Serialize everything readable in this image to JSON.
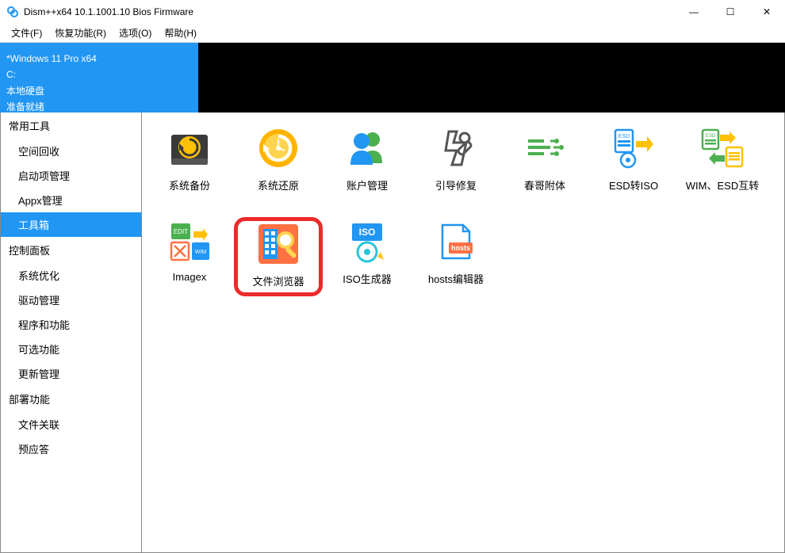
{
  "window": {
    "title": "Dism++x64 10.1.1001.10 Bios Firmware",
    "min": "—",
    "max": "☐",
    "close": "✕"
  },
  "menu": [
    "文件(F)",
    "恢复功能(R)",
    "选项(O)",
    "帮助(H)"
  ],
  "banner": {
    "os": "*Windows 11 Pro x64",
    "drive": "C:",
    "disk": "本地硬盘",
    "status": "准备就绪"
  },
  "sidebar": {
    "sections": [
      {
        "header": "常用工具",
        "items": [
          {
            "label": "空间回收",
            "selected": false
          },
          {
            "label": "启动项管理",
            "selected": false
          },
          {
            "label": "Appx管理",
            "selected": false
          },
          {
            "label": "工具箱",
            "selected": true
          }
        ]
      },
      {
        "header": "控制面板",
        "items": [
          {
            "label": "系统优化",
            "selected": false
          },
          {
            "label": "驱动管理",
            "selected": false
          },
          {
            "label": "程序和功能",
            "selected": false
          },
          {
            "label": "可选功能",
            "selected": false
          },
          {
            "label": "更新管理",
            "selected": false
          }
        ]
      },
      {
        "header": "部署功能",
        "items": [
          {
            "label": "文件关联",
            "selected": false
          },
          {
            "label": "预应答",
            "selected": false
          }
        ]
      }
    ]
  },
  "tools": [
    {
      "label": "系统备份",
      "icon": "backup",
      "highlight": false
    },
    {
      "label": "系统还原",
      "icon": "restore",
      "highlight": false
    },
    {
      "label": "账户管理",
      "icon": "accounts",
      "highlight": false
    },
    {
      "label": "引导修复",
      "icon": "bootfix",
      "highlight": false
    },
    {
      "label": "春哥附体",
      "icon": "god",
      "highlight": false
    },
    {
      "label": "ESD转ISO",
      "icon": "esd2iso",
      "highlight": false
    },
    {
      "label": "WIM、ESD互转",
      "icon": "wimesd",
      "highlight": false
    },
    {
      "label": "Imagex",
      "icon": "imagex",
      "highlight": false
    },
    {
      "label": "文件浏览器",
      "icon": "filebrowser",
      "highlight": true
    },
    {
      "label": "ISO生成器",
      "icon": "isogen",
      "highlight": false
    },
    {
      "label": "hosts编辑器",
      "icon": "hosts",
      "highlight": false
    }
  ]
}
